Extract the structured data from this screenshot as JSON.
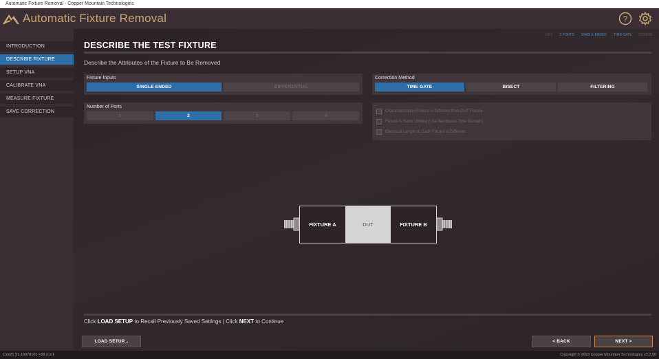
{
  "window": {
    "title": "Automatic Fixture Removal - Copper Mountain Technologies"
  },
  "header": {
    "title": "Automatic Fixture Removal",
    "icons": [
      "help-icon",
      "gear-icon"
    ]
  },
  "sidebar": {
    "items": [
      {
        "label": "INTRODUCTION",
        "active": false
      },
      {
        "label": "DESCRIBE FIXTURE",
        "active": true
      },
      {
        "label": "SETUP VNA",
        "active": false
      },
      {
        "label": "CALIBRATE VNA",
        "active": false
      },
      {
        "label": "MEASURE FIXTURE",
        "active": false
      },
      {
        "label": "SAVE CORRECTION",
        "active": false
      }
    ]
  },
  "progress": {
    "steps": [
      "FIXT",
      "2 PORTS",
      "SINGLE ENDED",
      "TIME GATE",
      "CONFIG"
    ]
  },
  "main": {
    "title": "DESCRIBE THE TEST FIXTURE",
    "subtitle": "Describe the Attributes of the Fixture to Be Removed",
    "fixture_inputs": {
      "label": "Fixture Inputs",
      "options": [
        "SINGLE ENDED",
        "DIFFERENTIAL"
      ],
      "selected": "SINGLE ENDED"
    },
    "number_of_ports": {
      "label": "Number of Ports",
      "options": [
        "1",
        "2",
        "3",
        "4"
      ],
      "selected": "2"
    },
    "correction_method": {
      "label": "Correction Method",
      "options": [
        "TIME GATE",
        "BISECT",
        "FILTERING"
      ],
      "selected": "TIME GATE"
    },
    "checkboxes": [
      {
        "label": "Characterization Fixture is Different from DUT Fixture",
        "checked": false
      },
      {
        "label": "Fixture is Band Limited (Use Bandpass Time Domain)",
        "checked": false
      },
      {
        "label": "Electrical Length of Each Fixture is Different",
        "checked": false
      }
    ],
    "diagram": {
      "fixture_a": "FIXTURE A",
      "dut": "DUT",
      "fixture_b": "FIXTURE B"
    },
    "instruction": {
      "part1": "Click ",
      "load": "LOAD SETUP",
      "part2": " to Recall Previously Saved Settings | Click ",
      "next": "NEXT",
      "part3": " to Continue"
    }
  },
  "buttons": {
    "load_setup": "LOAD SETUP...",
    "back": "< BACK",
    "next": "NEXT >"
  },
  "status": {
    "left": "C2220   S1.16078101   =28.2.1/1",
    "right": "Copyright © 2023 Copper Mountain Technologies v3.0.50"
  },
  "colors": {
    "accent": "#2f6fa8",
    "title": "#c8a873",
    "next_border": "#c9893a"
  }
}
